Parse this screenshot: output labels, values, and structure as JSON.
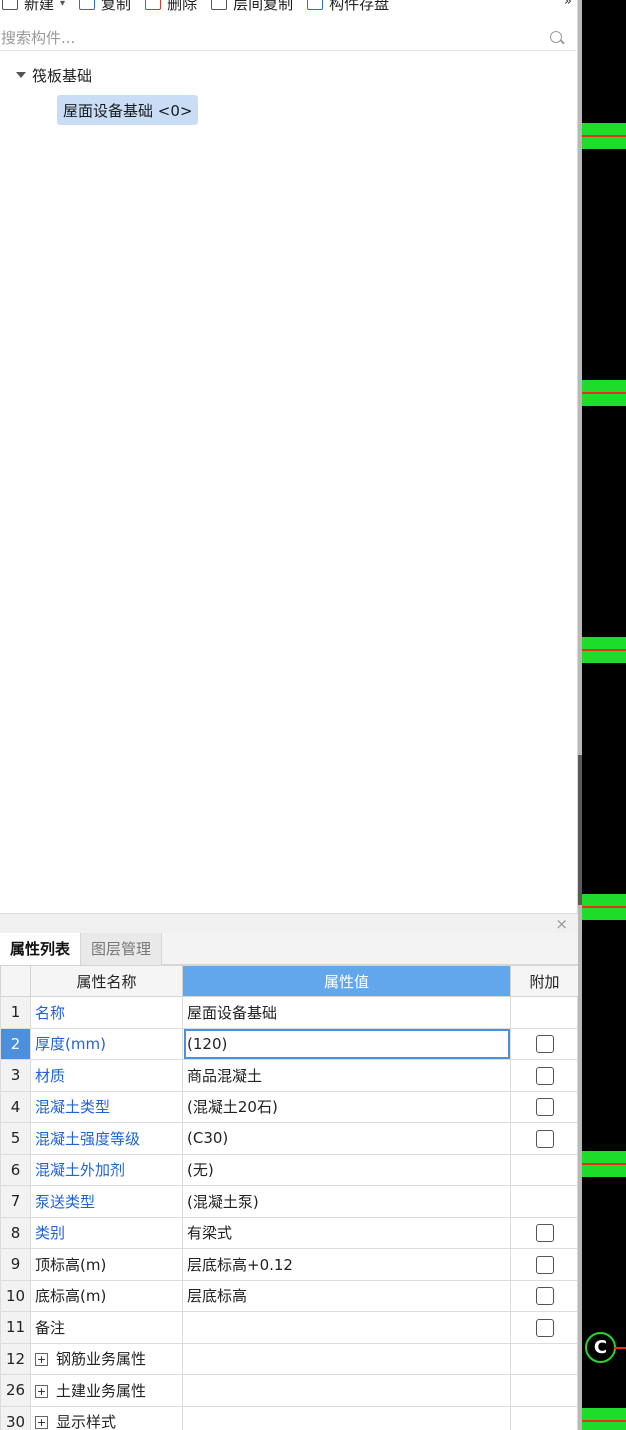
{
  "toolbar": {
    "new_label": "新建",
    "copy_label": "复制",
    "delete_label": "删除",
    "floor_copy_label": "层间复制",
    "save_component_label": "构件存盘"
  },
  "search": {
    "placeholder": "搜索构件..."
  },
  "tree": {
    "parent": "筏板基础",
    "child": "屋面设备基础 <0>"
  },
  "props": {
    "tab_attr": "属性列表",
    "tab_layer": "图层管理",
    "headers": {
      "name": "属性名称",
      "value": "属性值",
      "extra": "附加"
    },
    "rows": [
      {
        "num": "1",
        "name": "名称",
        "value": "屋面设备基础"
      },
      {
        "num": "2",
        "name": "厚度(mm)",
        "value": "(120)"
      },
      {
        "num": "3",
        "name": "材质",
        "value": "商品混凝土"
      },
      {
        "num": "4",
        "name": "混凝土类型",
        "value": "(混凝土20石)"
      },
      {
        "num": "5",
        "name": "混凝土强度等级",
        "value": "(C30)"
      },
      {
        "num": "6",
        "name": "混凝土外加剂",
        "value": "(无)"
      },
      {
        "num": "7",
        "name": "泵送类型",
        "value": "(混凝土泵)"
      },
      {
        "num": "8",
        "name": "类别",
        "value": "有梁式"
      },
      {
        "num": "9",
        "name": "顶标高(m)",
        "value": "层底标高+0.12"
      },
      {
        "num": "10",
        "name": "底标高(m)",
        "value": "层底标高"
      },
      {
        "num": "11",
        "name": "备注",
        "value": ""
      },
      {
        "num": "12",
        "name": "钢筋业务属性",
        "value": ""
      },
      {
        "num": "26",
        "name": "土建业务属性",
        "value": ""
      },
      {
        "num": "30",
        "name": "显示样式",
        "value": ""
      }
    ]
  },
  "canvas": {
    "axis_marker": "C"
  }
}
